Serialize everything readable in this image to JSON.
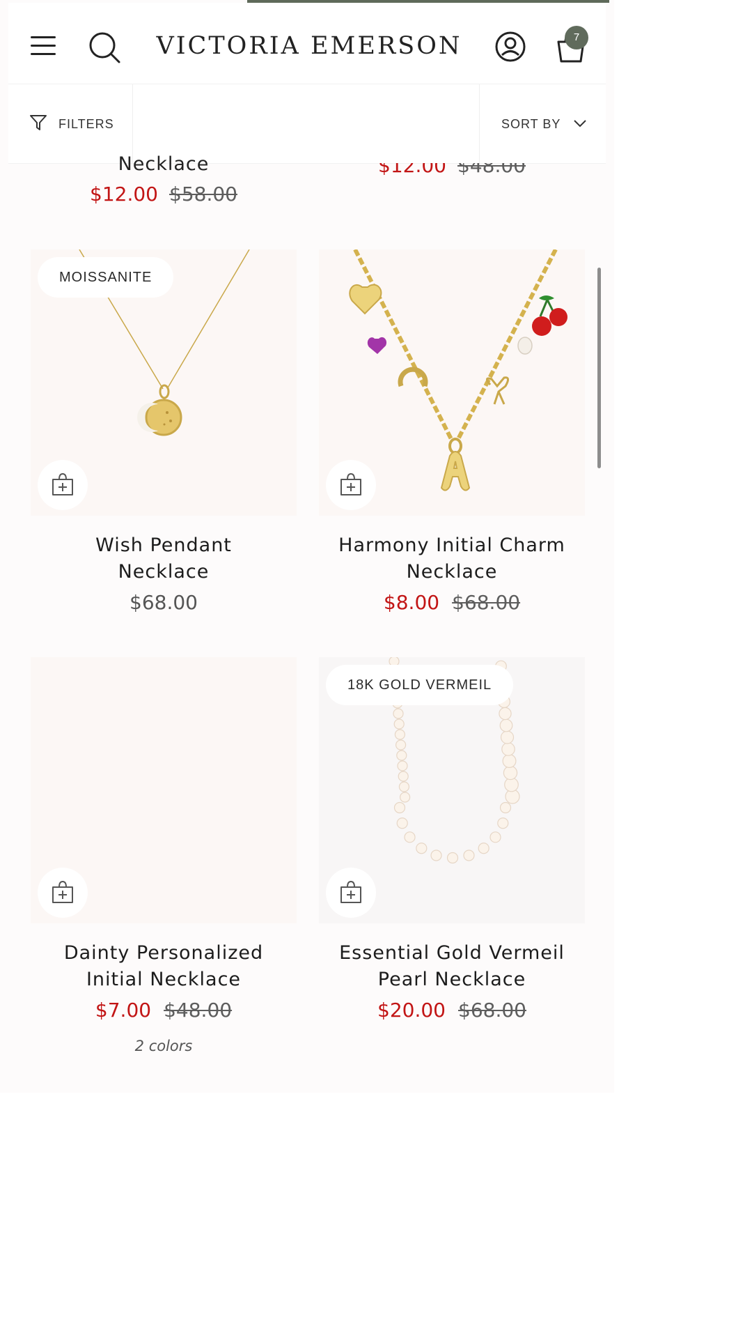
{
  "header": {
    "brand": "VICTORIA EMERSON",
    "cart_count": "7",
    "icons": [
      "menu-icon",
      "search-icon",
      "account-icon",
      "cart-icon"
    ]
  },
  "toolbar": {
    "filters_label": "FILTERS",
    "sort_label": "SORT BY"
  },
  "partial_row": [
    {
      "title": "Necklace",
      "sale_price": "$12.00",
      "original_price": "$58.00"
    },
    {
      "sale_price": "$12.00",
      "original_price": "$48.00"
    }
  ],
  "products": [
    {
      "badge": "MOISSANITE",
      "title_line1": "Wish Pendant",
      "title_line2": "Necklace",
      "price": "$68.00"
    },
    {
      "title_line1": "Harmony Initial Charm",
      "title_line2": "Necklace",
      "sale_price": "$8.00",
      "original_price": "$68.00"
    },
    {
      "title_line1": "Dainty Personalized",
      "title_line2": "Initial Necklace",
      "sale_price": "$7.00",
      "original_price": "$48.00",
      "colors_note": "2 colors"
    },
    {
      "badge": "18K GOLD VERMEIL",
      "title_line1": "Essential Gold Vermeil",
      "title_line2": "Pearl Necklace",
      "sale_price": "$20.00",
      "original_price": "$68.00"
    }
  ],
  "colors": {
    "sale": "#c21515",
    "badge_bg": "#606b5c",
    "gold": "#d9b64f"
  }
}
